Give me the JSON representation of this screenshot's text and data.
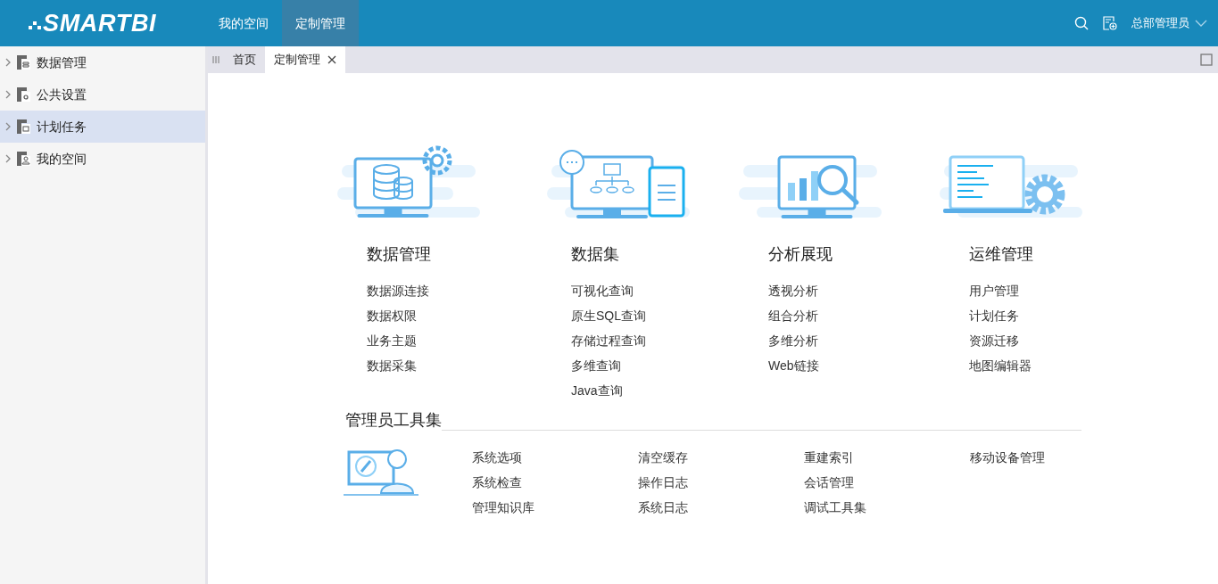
{
  "header": {
    "logo": "SMARTBI",
    "nav": [
      {
        "label": "我的空间",
        "selected": false
      },
      {
        "label": "定制管理",
        "selected": true
      }
    ],
    "user": "总部管理员"
  },
  "sidebar": {
    "items": [
      {
        "label": "数据管理",
        "selected": false,
        "kind": "table"
      },
      {
        "label": "公共设置",
        "selected": false,
        "kind": "gear"
      },
      {
        "label": "计划任务",
        "selected": true,
        "kind": "schedule"
      },
      {
        "label": "我的空间",
        "selected": false,
        "kind": "user"
      }
    ]
  },
  "tabs": [
    {
      "label": "首页",
      "selected": false,
      "closable": false
    },
    {
      "label": "定制管理",
      "selected": true,
      "closable": true
    }
  ],
  "modules": [
    {
      "kind": "database",
      "title": "数据管理",
      "links": [
        "数据源连接",
        "数据权限",
        "业务主题",
        "数据采集"
      ]
    },
    {
      "kind": "dataset",
      "title": "数据集",
      "links": [
        "可视化查询",
        "原生SQL查询",
        "存储过程查询",
        "多维查询",
        "Java查询"
      ]
    },
    {
      "kind": "analysis",
      "title": "分析展现",
      "links": [
        "透视分析",
        "组合分析",
        "多维分析",
        "Web链接"
      ]
    },
    {
      "kind": "ops",
      "title": "运维管理",
      "links": [
        "用户管理",
        "计划任务",
        "资源迁移",
        "地图编辑器"
      ]
    }
  ],
  "admin_tools": {
    "title": "管理员工具集",
    "columns": [
      [
        "系统选项",
        "系统检查",
        "管理知识库"
      ],
      [
        "清空缓存",
        "操作日志",
        "系统日志"
      ],
      [
        "重建索引",
        "会话管理",
        "调试工具集"
      ],
      [
        "移动设备管理"
      ]
    ]
  }
}
